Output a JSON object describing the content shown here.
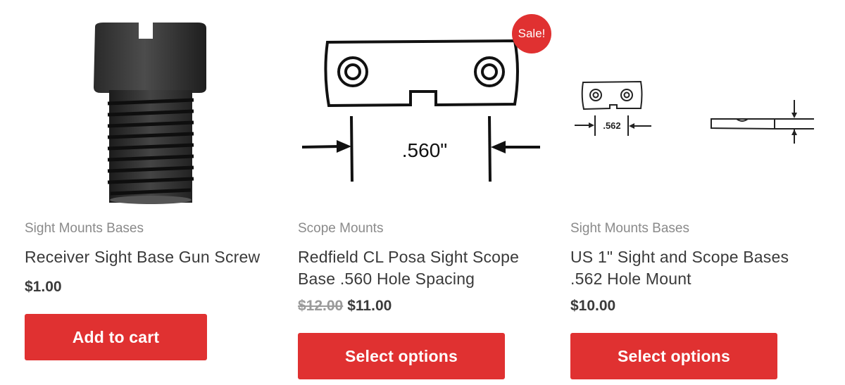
{
  "products": [
    {
      "category": "Sight Mounts Bases",
      "title": "Receiver Sight Base Gun Screw",
      "price": "$1.00",
      "button_label": "Add to cart"
    },
    {
      "badge": "Sale!",
      "category": "Scope Mounts",
      "title": "Redfield CL Posa Sight Scope Base .560 Hole Spacing",
      "old_price": "$12.00",
      "price": "$11.00",
      "button_label": "Select options",
      "image_label": ".560\""
    },
    {
      "category": "Sight Mounts Bases",
      "title": "US 1\" Sight and Scope Bases .562 Hole Mount",
      "price": "$10.00",
      "button_label": "Select options",
      "image_label": ".562"
    }
  ],
  "colors": {
    "accent": "#e03131",
    "category_text": "#8a8a8a",
    "title_text": "#3a3a3a"
  }
}
